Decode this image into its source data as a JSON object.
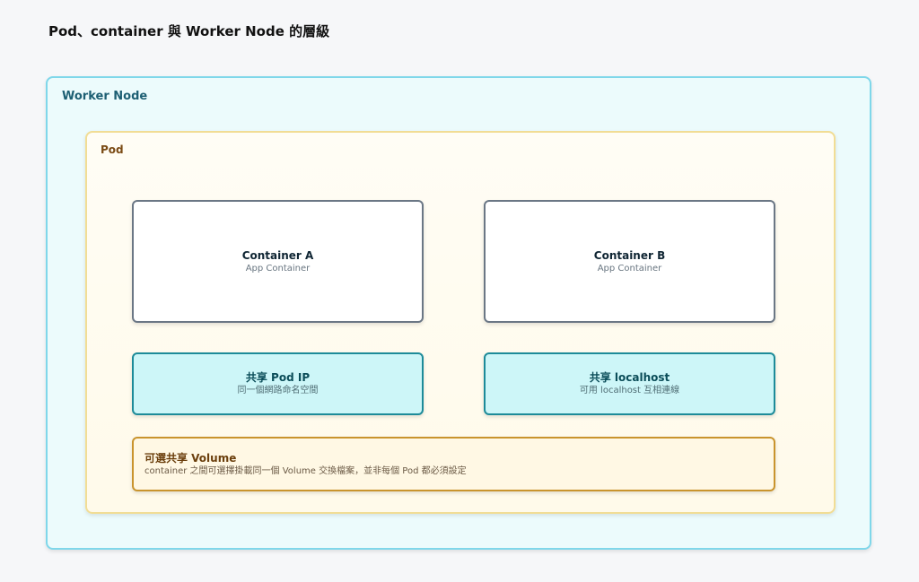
{
  "title": "Pod、container 與 Worker Node 的層級",
  "worker_node": {
    "label": "Worker Node",
    "pod": {
      "label": "Pod",
      "containers": [
        {
          "name": "Container A",
          "subtitle": "App Container"
        },
        {
          "name": "Container B",
          "subtitle": "App Container"
        }
      ],
      "shared": [
        {
          "title": "共享 Pod IP",
          "subtitle": "同一個網路命名空間"
        },
        {
          "title": "共享 localhost",
          "subtitle": "可用 localhost 互相連線"
        }
      ],
      "volume": {
        "title": "可選共享 Volume",
        "subtitle": "container 之間可選擇掛載同一個 Volume 交換檔案，並非每個 Pod 都必須設定"
      }
    }
  },
  "colors": {
    "worker_border": "#7fd7ea",
    "worker_fill": "#ecfbfc",
    "pod_border": "#f1dd95",
    "pod_fill": "#fffaea",
    "shared_fill": "#cdf6f8",
    "shared_border": "#1d8b99",
    "volume_fill": "#fff8e4",
    "volume_border": "#c9942d"
  }
}
